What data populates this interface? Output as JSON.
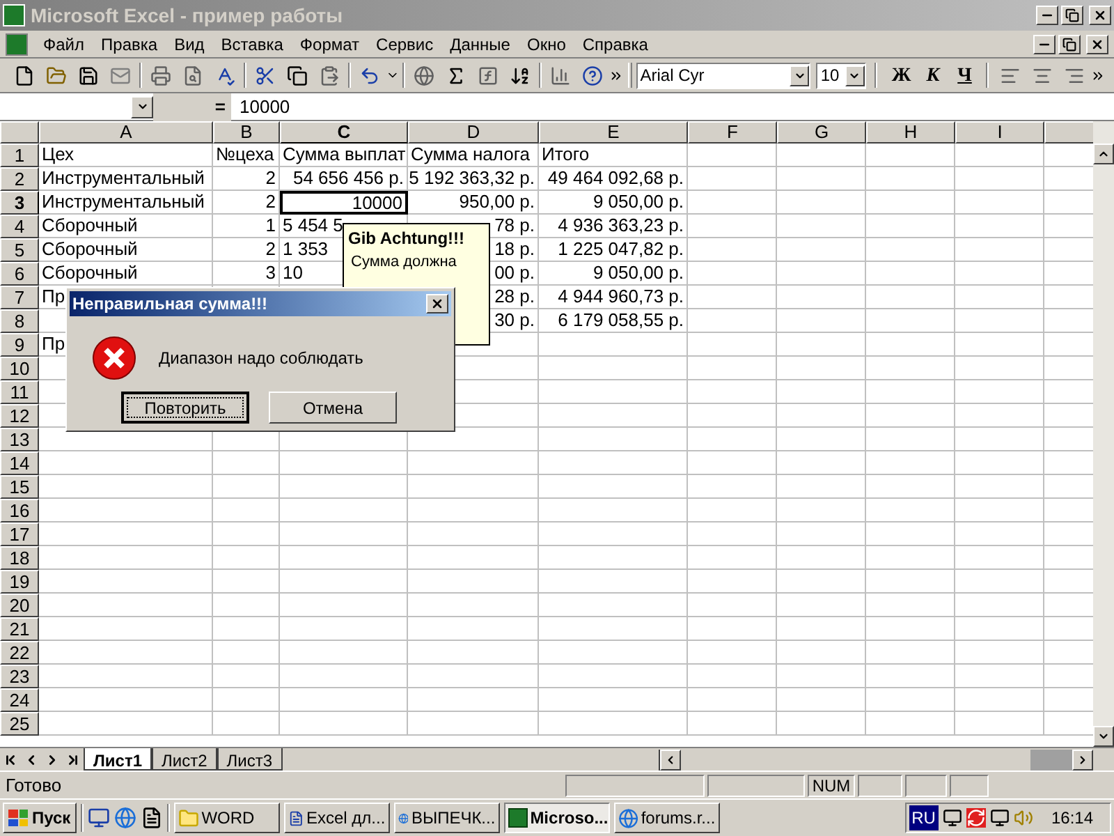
{
  "window": {
    "title": "Microsoft Excel - пример работы"
  },
  "menu": [
    "Файл",
    "Правка",
    "Вид",
    "Вставка",
    "Формат",
    "Сервис",
    "Данные",
    "Окно",
    "Справка"
  ],
  "toolbar": {
    "font": "Arial Cyr",
    "size": "10",
    "format_buttons": [
      {
        "label": "Ж",
        "kind": "bold"
      },
      {
        "label": "К",
        "kind": "italic"
      },
      {
        "label": "Ч",
        "kind": "underline"
      }
    ]
  },
  "formula_bar": {
    "equals": "=",
    "value": "10000"
  },
  "columns": [
    {
      "label": "A",
      "selected": false
    },
    {
      "label": "B",
      "selected": false
    },
    {
      "label": "C",
      "selected": true
    },
    {
      "label": "D",
      "selected": false
    },
    {
      "label": "E",
      "selected": false
    },
    {
      "label": "F",
      "selected": false
    },
    {
      "label": "G",
      "selected": false
    },
    {
      "label": "H",
      "selected": false
    },
    {
      "label": "I",
      "selected": false
    }
  ],
  "rows": [
    {
      "header": "1",
      "selected": false,
      "cells": [
        {
          "text": "Цех",
          "kind": "text"
        },
        {
          "text": "№цеха",
          "kind": "text"
        },
        {
          "text": "Сумма выплат",
          "kind": "text"
        },
        {
          "text": "Сумма налога",
          "kind": "text"
        },
        {
          "text": "Итого",
          "kind": "text"
        }
      ]
    },
    {
      "header": "2",
      "selected": false,
      "cells": [
        {
          "text": "Инструментальный",
          "kind": "text"
        },
        {
          "text": "2",
          "kind": "number"
        },
        {
          "text": "54 656 456 р.",
          "kind": "number"
        },
        {
          "text": "5 192 363,32 р.",
          "kind": "number"
        },
        {
          "text": "49 464 092,68 р.",
          "kind": "number"
        }
      ]
    },
    {
      "header": "3",
      "selected": true,
      "cells": [
        {
          "text": "Инструментальный",
          "kind": "text"
        },
        {
          "text": "2",
          "kind": "number"
        },
        {
          "text": "10000",
          "kind": "number"
        },
        {
          "text": "950,00 р.",
          "kind": "number"
        },
        {
          "text": "9 050,00 р.",
          "kind": "number"
        }
      ]
    },
    {
      "header": "4",
      "selected": false,
      "cells": [
        {
          "text": "Сборочный",
          "kind": "text"
        },
        {
          "text": "1",
          "kind": "number"
        },
        {
          "text": "5 454 5",
          "kind": "text"
        },
        {
          "text": "78 р.",
          "kind": "number"
        },
        {
          "text": "4 936 363,23 р.",
          "kind": "number"
        }
      ]
    },
    {
      "header": "5",
      "selected": false,
      "cells": [
        {
          "text": "Сборочный",
          "kind": "text"
        },
        {
          "text": "2",
          "kind": "number"
        },
        {
          "text": "1 353",
          "kind": "text"
        },
        {
          "text": "18 р.",
          "kind": "number"
        },
        {
          "text": "1 225 047,82 р.",
          "kind": "number"
        }
      ]
    },
    {
      "header": "6",
      "selected": false,
      "cells": [
        {
          "text": "Сборочный",
          "kind": "text"
        },
        {
          "text": "3",
          "kind": "number"
        },
        {
          "text": "10",
          "kind": "text"
        },
        {
          "text": "00 р.",
          "kind": "number"
        },
        {
          "text": "9 050,00 р.",
          "kind": "number"
        }
      ]
    },
    {
      "header": "7",
      "selected": false,
      "cells": [
        {
          "text": "Пр",
          "kind": "text"
        },
        {},
        {},
        {
          "text": "28 р.",
          "kind": "number"
        },
        {
          "text": "4 944 960,73 р.",
          "kind": "number"
        }
      ]
    },
    {
      "header": "8",
      "selected": false,
      "cells": [
        {},
        {},
        {},
        {
          "text": "30 р.",
          "kind": "number"
        },
        {
          "text": "6 179 058,55 р.",
          "kind": "number"
        }
      ]
    },
    {
      "header": "9",
      "selected": false,
      "cells": [
        {
          "text": "Пр",
          "kind": "text"
        }
      ]
    },
    {
      "header": "10",
      "selected": false,
      "cells": []
    },
    {
      "header": "11",
      "selected": false,
      "cells": []
    },
    {
      "header": "12",
      "selected": false,
      "cells": []
    },
    {
      "header": "13",
      "selected": false,
      "cells": []
    },
    {
      "header": "14",
      "selected": false,
      "cells": []
    },
    {
      "header": "15",
      "selected": false,
      "cells": []
    },
    {
      "header": "16",
      "selected": false,
      "cells": []
    },
    {
      "header": "17",
      "selected": false,
      "cells": []
    },
    {
      "header": "18",
      "selected": false,
      "cells": []
    },
    {
      "header": "19",
      "selected": false,
      "cells": []
    },
    {
      "header": "20",
      "selected": false,
      "cells": []
    },
    {
      "header": "21",
      "selected": false,
      "cells": []
    },
    {
      "header": "22",
      "selected": false,
      "cells": []
    },
    {
      "header": "23",
      "selected": false,
      "cells": []
    },
    {
      "header": "24",
      "selected": false,
      "cells": []
    },
    {
      "header": "25",
      "selected": false,
      "cells": []
    }
  ],
  "tooltip": {
    "title": "Gib Achtung!!!",
    "lines": [
      "Сумма должна"
    ]
  },
  "dialog": {
    "title": "Неправильная сумма!!!",
    "message": "Диапазон надо соблюдать",
    "buttons": [
      {
        "label": "Повторить",
        "selected": true
      },
      {
        "label": "Отмена",
        "selected": false
      }
    ]
  },
  "sheet_tabs": [
    {
      "label": "Лист1",
      "selected": true
    },
    {
      "label": "Лист2",
      "selected": false
    },
    {
      "label": "Лист3",
      "selected": false
    }
  ],
  "status_bar": {
    "text": "Готово",
    "indicator": "NUM"
  },
  "taskbar": {
    "start": "Пуск",
    "tasks": [
      {
        "label": "WORD",
        "kind": "folder",
        "selected": false
      },
      {
        "label": "Excel дл...",
        "kind": "word",
        "selected": false
      },
      {
        "label": "ВЫПЕЧК...",
        "kind": "ie",
        "selected": false
      },
      {
        "label": "Microso...",
        "kind": "excel",
        "selected": true
      },
      {
        "label": "forums.r...",
        "kind": "ie",
        "selected": false
      }
    ],
    "language": "RU",
    "time": "16:14"
  }
}
